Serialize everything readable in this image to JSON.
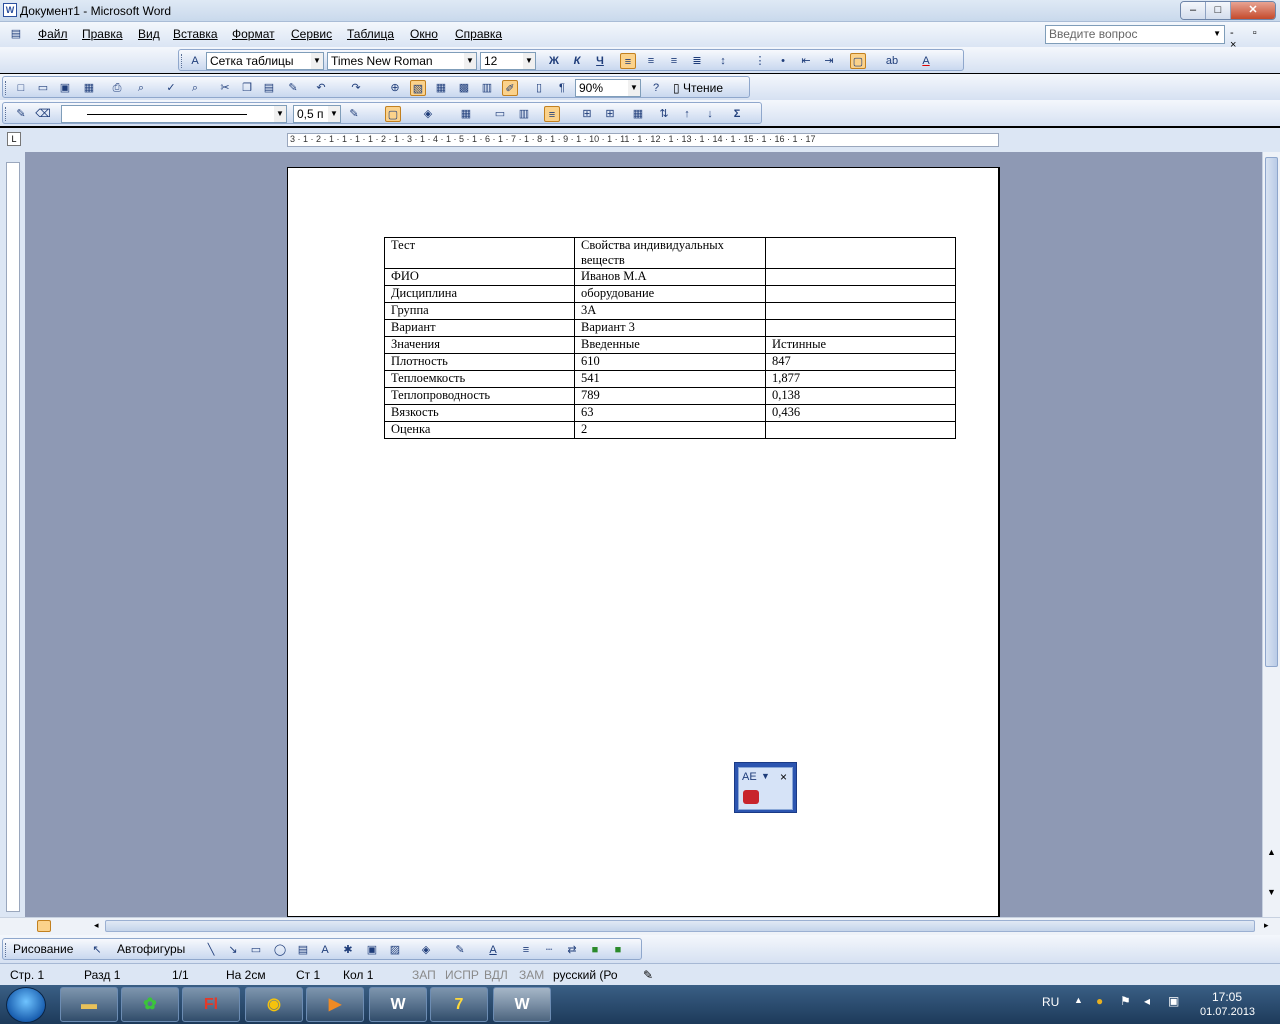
{
  "window": {
    "title": "Документ1 - Microsoft Word",
    "min": "–",
    "max": "□",
    "close": "✕"
  },
  "menu": [
    "Файл",
    "Правка",
    "Вид",
    "Вставка",
    "Формат",
    "Сервис",
    "Таблица",
    "Окно",
    "Справка"
  ],
  "ask": {
    "placeholder": "Введите вопрос",
    "doc_controls": "- ▫ ×"
  },
  "formatting": {
    "style": "Сетка таблицы",
    "font": "Times New Roman",
    "size": "12",
    "bold": "Ж",
    "italic": "К",
    "underline": "Ч"
  },
  "standard": {
    "zoom": "90%",
    "read_label": "Чтение",
    "pilcrow": "¶"
  },
  "tables_borders": {
    "line_weight": "0,5 п",
    "sum": "Σ"
  },
  "ruler": {
    "corner": "L",
    "ticks": "3 · 1 · 2 · 1 · 1 · 1 · 1 · 2 · 1 · 3 · 1 · 4 · 1 · 5 · 1 · 6 · 1 · 7 · 1 · 8 · 1 · 9 · 1 · 10 · 1 · 11 · 1 · 12 · 1 · 13 · 1 · 14 · 1 · 15 · 1 · 16 · 1 · 17"
  },
  "table": [
    [
      "Тест",
      "Свойства индивидуальных веществ",
      ""
    ],
    [
      "ФИО",
      "Иванов М.А",
      ""
    ],
    [
      "Дисциплина",
      "оборудование",
      ""
    ],
    [
      "Группа",
      "3А",
      ""
    ],
    [
      "Вариант",
      "Вариант 3",
      ""
    ],
    [
      "Значения",
      "Введенные",
      "Истинные"
    ],
    [
      "Плотность",
      "610",
      "847"
    ],
    [
      "Теплоемкость",
      "541",
      "1,877"
    ],
    [
      "Теплопроводность",
      "789",
      "0,138"
    ],
    [
      "Вязкость",
      "63",
      "0,436"
    ],
    [
      "Оценка",
      "2",
      ""
    ]
  ],
  "floating": {
    "label": "АЕ"
  },
  "drawing": {
    "draw": "Рисование",
    "autoshapes": "Автофигуры"
  },
  "status": {
    "page": "Стр. 1",
    "section": "Разд 1",
    "pages": "1/1",
    "at": "На 2см",
    "line": "Ст 1",
    "col": "Кол 1",
    "rec": "ЗАП",
    "trk": "ИСПР",
    "ext": "ВДЛ",
    "ovr": "ЗАМ",
    "lang": "русский (Ро"
  },
  "taskbar": {
    "lang": "RU",
    "time": "17:05",
    "date": "01.07.2013"
  }
}
